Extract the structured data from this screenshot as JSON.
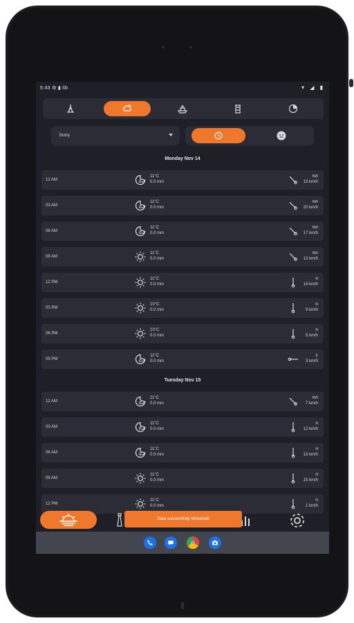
{
  "status_bar": {
    "time": "5:43",
    "left_icons": "⚙ ▮ lib",
    "right_icons": "▾ ◢ ▮"
  },
  "tabs": [
    {
      "icon": "tide-icon",
      "active": false
    },
    {
      "icon": "weather-icon",
      "active": true
    },
    {
      "icon": "boat-icon",
      "active": false
    },
    {
      "icon": "lighthouse-icon",
      "active": false
    },
    {
      "icon": "fishing-icon",
      "active": false
    }
  ],
  "location": {
    "value": "buoy"
  },
  "toggle": {
    "left_icon": "history-icon",
    "right_icon": "face-icon",
    "active": "left"
  },
  "days": [
    {
      "title": "Monday Nov 14",
      "rows": [
        {
          "time": "12 AM",
          "icon": "moon-cloud",
          "temp": "11°C",
          "rain": "0.0 mm",
          "dir": "NW",
          "speed": "13 km/h"
        },
        {
          "time": "03 AM",
          "icon": "moon-cloud",
          "temp": "11°C",
          "rain": "0.0 mm",
          "dir": "NW",
          "speed": "20 km/h"
        },
        {
          "time": "06 AM",
          "icon": "moon-cloud",
          "temp": "11°C",
          "rain": "0.0 mm",
          "dir": "NW",
          "speed": "17 km/h"
        },
        {
          "time": "09 AM",
          "icon": "sun",
          "temp": "11°C",
          "rain": "0.0 mm",
          "dir": "NW",
          "speed": "13 km/h"
        },
        {
          "time": "12 PM",
          "icon": "sun",
          "temp": "11°C",
          "rain": "0.0 mm",
          "dir": "N",
          "speed": "14 km/h"
        },
        {
          "time": "03 PM",
          "icon": "sun",
          "temp": "10°C",
          "rain": "0.0 mm",
          "dir": "N",
          "speed": "9 km/h"
        },
        {
          "time": "06 PM",
          "icon": "sun",
          "temp": "10°C",
          "rain": "0.0 mm",
          "dir": "N",
          "speed": "5 km/h"
        },
        {
          "time": "09 PM",
          "icon": "moon-cloud",
          "temp": "11°C",
          "rain": "0.0 mm",
          "dir": "E",
          "speed": "3 km/h"
        }
      ]
    },
    {
      "title": "Tuesday Nov 15",
      "rows": [
        {
          "time": "12 AM",
          "icon": "moon-cloud",
          "temp": "11°C",
          "rain": "0.0 mm",
          "dir": "NW",
          "speed": "7 km/h"
        },
        {
          "time": "03 AM",
          "icon": "moon-cloud",
          "temp": "11°C",
          "rain": "0.0 mm",
          "dir": "N",
          "speed": "12 km/h"
        },
        {
          "time": "06 AM",
          "icon": "moon-cloud",
          "temp": "11°C",
          "rain": "0.0 mm",
          "dir": "N",
          "speed": "13 km/h"
        },
        {
          "time": "09 AM",
          "icon": "sun",
          "temp": "11°C",
          "rain": "0.0 mm",
          "dir": "N",
          "speed": "15 km/h"
        },
        {
          "time": "12 PM",
          "icon": "sun",
          "temp": "11°C",
          "rain": "0.0 mm",
          "dir": "N",
          "speed": "1 km/h"
        }
      ]
    }
  ],
  "bottom_nav": {
    "items": [
      "sunrise-icon",
      "lighthouse-icon",
      "sun-icon",
      "chart-icon",
      "settings-icon"
    ],
    "active": "sunrise-icon"
  },
  "toast": {
    "text": "Data successfully refreshed!"
  },
  "system_nav": {
    "apps": [
      "phone-icon",
      "messages-icon",
      "chrome-icon",
      "camera-icon"
    ]
  },
  "colors": {
    "accent": "#f0782d",
    "background": "#1f2027",
    "card": "#2b2c35",
    "text": "#d8d8d8"
  }
}
